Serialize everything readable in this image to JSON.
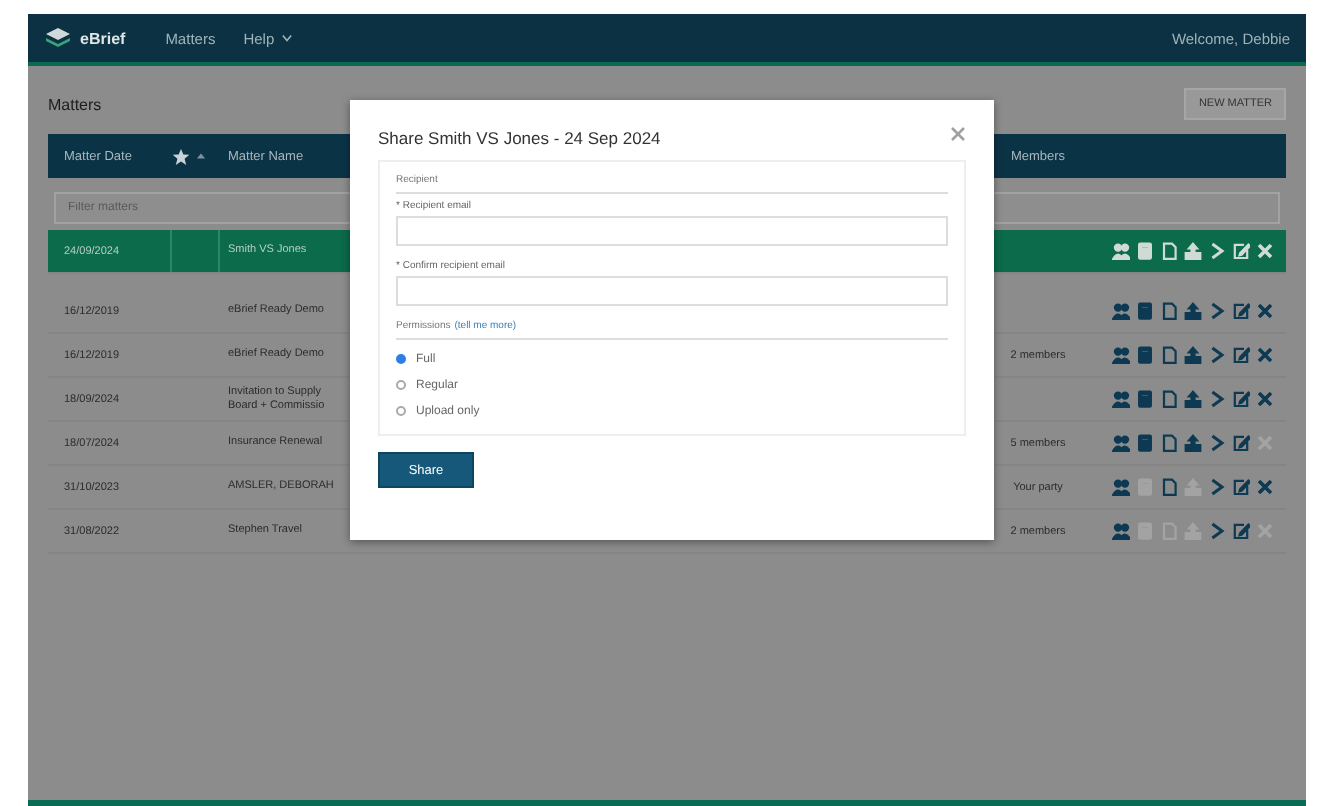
{
  "nav": {
    "brand": "eBrief",
    "menu": [
      {
        "label": "Matters"
      },
      {
        "label": "Help",
        "dropdown": true
      }
    ],
    "user": "Welcome, Debbie"
  },
  "page": {
    "title": "Matters",
    "new_button": "NEW MATTER"
  },
  "table": {
    "columns": {
      "date": "Matter Date",
      "name": "Matter Name",
      "members": "Members"
    },
    "filter": {
      "placeholder": "Filter matters"
    },
    "rows": [
      {
        "date": "24/09/2024",
        "name": [
          "Smith VS Jones"
        ],
        "members": "",
        "selected": true,
        "actions": [
          {
            "kind": "people",
            "disabled": false
          },
          {
            "kind": "book",
            "disabled": false
          },
          {
            "kind": "document",
            "disabled": false
          },
          {
            "kind": "upload",
            "disabled": false
          },
          {
            "kind": "chevron",
            "disabled": false
          },
          {
            "kind": "edit",
            "disabled": false
          },
          {
            "kind": "delete",
            "disabled": false
          }
        ]
      },
      {
        "date": "16/12/2019",
        "name": [
          "eBrief Ready Demo"
        ],
        "members": "",
        "selected": false,
        "actions": [
          {
            "kind": "people",
            "disabled": false
          },
          {
            "kind": "book",
            "disabled": false
          },
          {
            "kind": "document",
            "disabled": false
          },
          {
            "kind": "upload",
            "disabled": false
          },
          {
            "kind": "chevron",
            "disabled": false
          },
          {
            "kind": "edit",
            "disabled": false
          },
          {
            "kind": "delete",
            "disabled": false
          }
        ]
      },
      {
        "date": "16/12/2019",
        "name": [
          "eBrief Ready Demo"
        ],
        "members": "2 members",
        "selected": false,
        "actions": [
          {
            "kind": "people",
            "disabled": false
          },
          {
            "kind": "book",
            "disabled": false
          },
          {
            "kind": "document",
            "disabled": false
          },
          {
            "kind": "upload",
            "disabled": false
          },
          {
            "kind": "chevron",
            "disabled": false
          },
          {
            "kind": "edit",
            "disabled": false
          },
          {
            "kind": "delete",
            "disabled": false
          }
        ]
      },
      {
        "date": "18/09/2024",
        "name": [
          "Invitation to Supply",
          "Board + Commissio"
        ],
        "members": "",
        "selected": false,
        "actions": [
          {
            "kind": "people",
            "disabled": false
          },
          {
            "kind": "book",
            "disabled": false
          },
          {
            "kind": "document",
            "disabled": false
          },
          {
            "kind": "upload",
            "disabled": false
          },
          {
            "kind": "chevron",
            "disabled": false
          },
          {
            "kind": "edit",
            "disabled": false
          },
          {
            "kind": "delete",
            "disabled": false
          }
        ]
      },
      {
        "date": "18/07/2024",
        "name": [
          "Insurance Renewal"
        ],
        "members": "5 members",
        "selected": false,
        "actions": [
          {
            "kind": "people",
            "disabled": false
          },
          {
            "kind": "book",
            "disabled": false
          },
          {
            "kind": "document",
            "disabled": false
          },
          {
            "kind": "upload",
            "disabled": false
          },
          {
            "kind": "chevron",
            "disabled": false
          },
          {
            "kind": "edit",
            "disabled": false
          },
          {
            "kind": "delete",
            "disabled": true
          }
        ]
      },
      {
        "date": "31/10/2023",
        "name": [
          "AMSLER, DEBORAH"
        ],
        "members": "Your party",
        "selected": false,
        "actions": [
          {
            "kind": "people",
            "disabled": false
          },
          {
            "kind": "book",
            "disabled": true
          },
          {
            "kind": "document",
            "disabled": false
          },
          {
            "kind": "upload",
            "disabled": true
          },
          {
            "kind": "chevron",
            "disabled": false
          },
          {
            "kind": "edit",
            "disabled": false
          },
          {
            "kind": "delete",
            "disabled": false
          }
        ]
      },
      {
        "date": "31/08/2022",
        "name": [
          "Stephen Travel"
        ],
        "members": "2 members",
        "selected": false,
        "actions": [
          {
            "kind": "people",
            "disabled": false
          },
          {
            "kind": "book",
            "disabled": true
          },
          {
            "kind": "document",
            "disabled": true
          },
          {
            "kind": "upload",
            "disabled": true
          },
          {
            "kind": "chevron",
            "disabled": false
          },
          {
            "kind": "edit",
            "disabled": false
          },
          {
            "kind": "delete",
            "disabled": true
          }
        ]
      }
    ]
  },
  "dialog": {
    "title": "Share Smith VS Jones - 24 Sep 2024",
    "section": "Recipient",
    "fields": [
      {
        "label": "* Recipient email"
      },
      {
        "label": "* Confirm recipient email"
      }
    ],
    "permissions": {
      "label": "Permissions",
      "link": "(tell me more)",
      "options": [
        {
          "label": "Full",
          "selected": true
        },
        {
          "label": "Regular",
          "selected": false
        },
        {
          "label": "Upload only",
          "selected": false
        }
      ]
    },
    "button": "Share"
  }
}
